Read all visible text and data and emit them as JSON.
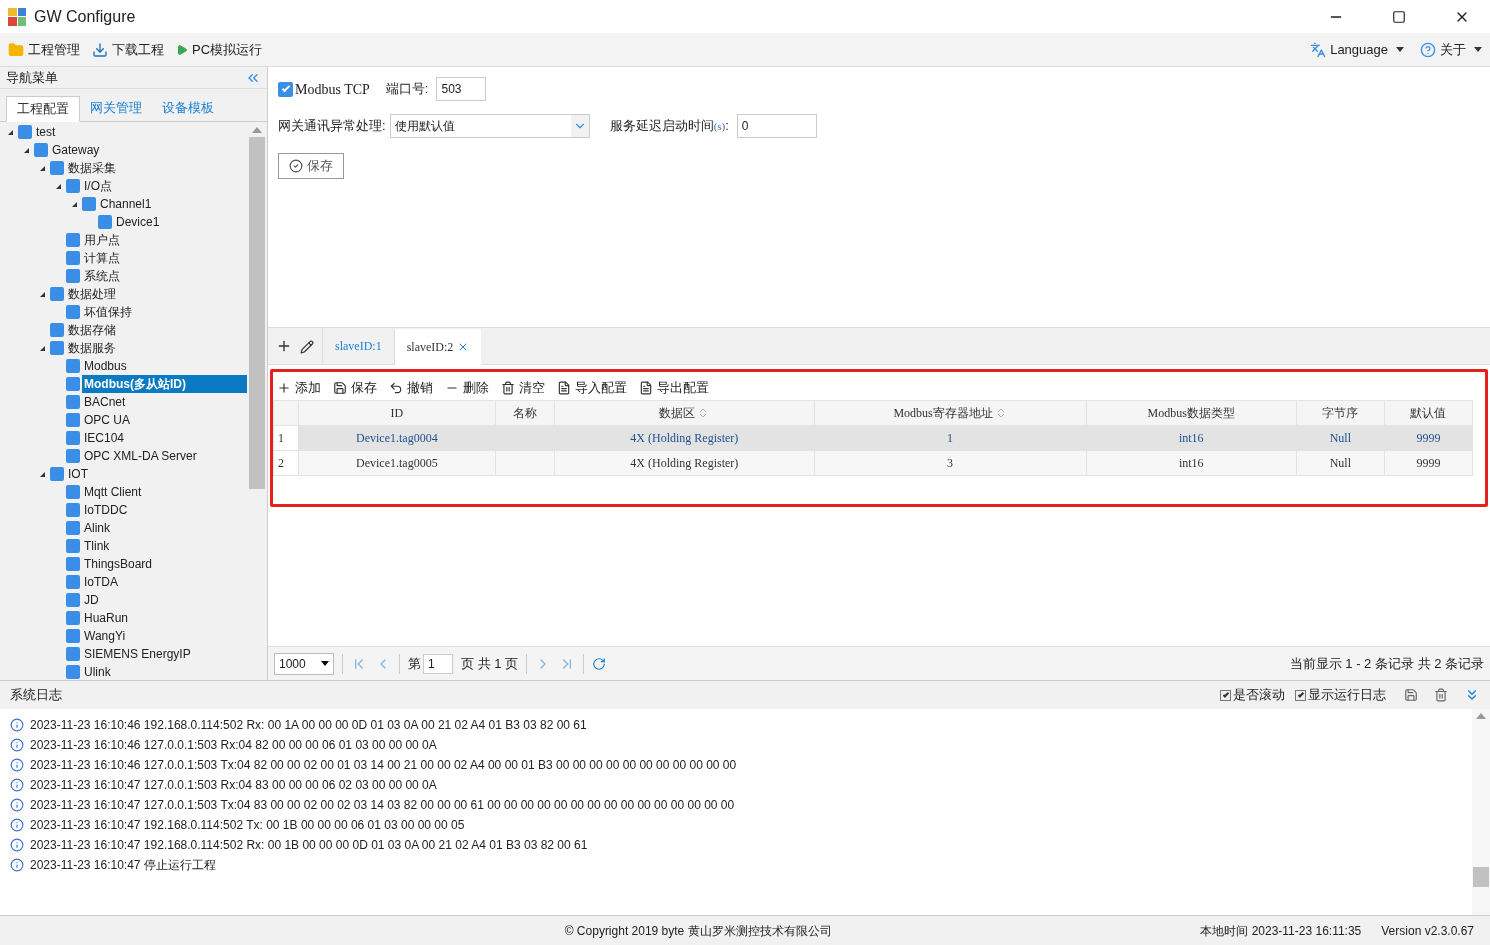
{
  "window": {
    "title": "GW Configure"
  },
  "toolbar": [
    {
      "label": "工程管理",
      "kind": "folder"
    },
    {
      "label": "下载工程",
      "kind": "download"
    },
    {
      "label": "PC模拟运行",
      "kind": "play"
    }
  ],
  "toolbar_right": [
    {
      "label": "Language",
      "kind": "language"
    },
    {
      "label": "关于",
      "kind": "help"
    }
  ],
  "sidebar": {
    "title": "导航菜单",
    "tabs": [
      {
        "label": "工程配置",
        "selected": true
      },
      {
        "label": "网关管理",
        "selected": false
      },
      {
        "label": "设备模板",
        "selected": false
      }
    ],
    "tree": [
      {
        "label": "test",
        "expanded": true,
        "selected": false,
        "children": [
          {
            "label": "Gateway",
            "expanded": true,
            "selected": false,
            "children": [
              {
                "label": "数据采集",
                "expanded": true,
                "selected": false,
                "children": [
                  {
                    "label": "I/O点",
                    "expanded": true,
                    "selected": false,
                    "children": [
                      {
                        "label": "Channel1",
                        "expanded": true,
                        "selected": false,
                        "children": [
                          {
                            "label": "Device1",
                            "selected": false
                          }
                        ]
                      }
                    ]
                  },
                  {
                    "label": "用户点",
                    "selected": false
                  },
                  {
                    "label": "计算点",
                    "selected": false
                  },
                  {
                    "label": "系统点",
                    "selected": false
                  }
                ]
              },
              {
                "label": "数据处理",
                "expanded": true,
                "selected": false,
                "children": [
                  {
                    "label": "坏值保持",
                    "selected": false
                  }
                ]
              },
              {
                "label": "数据存储",
                "selected": false
              },
              {
                "label": "数据服务",
                "expanded": true,
                "selected": false,
                "children": [
                  {
                    "label": "Modbus",
                    "selected": false
                  },
                  {
                    "label": "Modbus(多从站ID)",
                    "selected": true
                  },
                  {
                    "label": "BACnet",
                    "selected": false
                  },
                  {
                    "label": "OPC UA",
                    "selected": false
                  },
                  {
                    "label": "IEC104",
                    "selected": false
                  },
                  {
                    "label": "OPC XML-DA Server",
                    "selected": false
                  }
                ]
              },
              {
                "label": "IOT",
                "expanded": true,
                "selected": false,
                "children": [
                  {
                    "label": "Mqtt Client",
                    "selected": false
                  },
                  {
                    "label": "IoTDDC",
                    "selected": false
                  },
                  {
                    "label": "Alink",
                    "selected": false
                  },
                  {
                    "label": "Tlink",
                    "selected": false
                  },
                  {
                    "label": "ThingsBoard",
                    "selected": false
                  },
                  {
                    "label": "IoTDA",
                    "selected": false
                  },
                  {
                    "label": "JD",
                    "selected": false
                  },
                  {
                    "label": "HuaRun",
                    "selected": false
                  },
                  {
                    "label": "WangYi",
                    "selected": false
                  },
                  {
                    "label": "SIEMENS EnergyIP",
                    "selected": false
                  },
                  {
                    "label": "Ulink",
                    "selected": false
                  }
                ]
              }
            ]
          }
        ]
      }
    ]
  },
  "settings": {
    "modbus_tcp": {
      "label": "Modbus TCP",
      "checked": true
    },
    "port_label": "端口号:",
    "port": "503",
    "error_label": "网关通讯异常处理:",
    "error_value": "使用默认值",
    "delay_label": "服务延迟启动时间",
    "delay_unit": "(s)",
    "delay_colon": ":",
    "delay": "0",
    "save": "保存"
  },
  "slave_tabs": [
    {
      "label": "slaveID:1",
      "selected": false,
      "closable": false
    },
    {
      "label": "slaveID:2",
      "selected": true,
      "closable": true
    }
  ],
  "grid_toolbar": [
    {
      "label": "添加",
      "kind": "add"
    },
    {
      "label": "保存",
      "kind": "save"
    },
    {
      "label": "撤销",
      "kind": "undo"
    },
    {
      "label": "删除",
      "kind": "remove"
    },
    {
      "label": "清空",
      "kind": "clear"
    },
    {
      "label": "导入配置",
      "kind": "file"
    },
    {
      "label": "导出配置",
      "kind": "file"
    }
  ],
  "table": {
    "columns": [
      {
        "label": "ID",
        "sortable": false
      },
      {
        "label": "名称",
        "sortable": false
      },
      {
        "label": "数据区",
        "sortable": true
      },
      {
        "label": "Modbus寄存器地址",
        "sortable": true
      },
      {
        "label": "Modbus数据类型",
        "sortable": false
      },
      {
        "label": "字节序",
        "sortable": false
      },
      {
        "label": "默认值",
        "sortable": false
      }
    ],
    "rows": [
      {
        "num": "1",
        "selected": true,
        "cells": [
          "Device1.tag0004",
          "",
          "4X (Holding Register)",
          "1",
          "int16",
          "Null",
          "9999"
        ]
      },
      {
        "num": "2",
        "selected": false,
        "cells": [
          "Device1.tag0005",
          "",
          "4X (Holding Register)",
          "3",
          "int16",
          "Null",
          "9999"
        ]
      }
    ]
  },
  "pager": {
    "page_size": "1000",
    "page_prefix": "第",
    "page": "1",
    "page_suffix": "页 共 1 页",
    "summary": "当前显示 1 - 2 条记录 共 2 条记录"
  },
  "log": {
    "title": "系统日志",
    "options": [
      {
        "label": "是否滚动",
        "checked": true
      },
      {
        "label": "显示运行日志",
        "checked": true
      }
    ],
    "lines": [
      "2023-11-23 16:10:46 192.168.0.114:502 Rx: 00 1A 00 00 00 0D 01 03 0A 00 21 02 A4 01 B3 03 82 00 61",
      "2023-11-23 16:10:46 127.0.0.1:503 Rx:04 82 00 00 00 06 01 03 00 00 00 0A",
      "2023-11-23 16:10:46 127.0.0.1:503 Tx:04 82 00 00 02 00 01 03 14 00 21 00 00 02 A4 00 00 01 B3 00 00 00 00 00 00 00 00 00 00 00",
      "2023-11-23 16:10:47 127.0.0.1:503 Rx:04 83 00 00 00 06 02 03 00 00 00 0A",
      "2023-11-23 16:10:47 127.0.0.1:503 Tx:04 83 00 00 02 00 02 03 14 03 82 00 00 00 61 00 00 00 00 00 00 00 00 00 00 00 00 00 00 00",
      "2023-11-23 16:10:47 192.168.0.114:502 Tx: 00 1B 00 00 00 06 01 03 00 00 00 05",
      "2023-11-23 16:10:47 192.168.0.114:502 Rx: 00 1B 00 00 00 0D 01 03 0A 00 21 02 A4 01 B3 03 82 00 61",
      "2023-11-23 16:10:47 停止运行工程"
    ]
  },
  "status_bar": {
    "copyright": "© Copyright 2019 byte 黄山罗米测控技术有限公司",
    "time": "本地时间 2023-11-23 16:11:35",
    "version": "Version v2.3.0.67"
  }
}
